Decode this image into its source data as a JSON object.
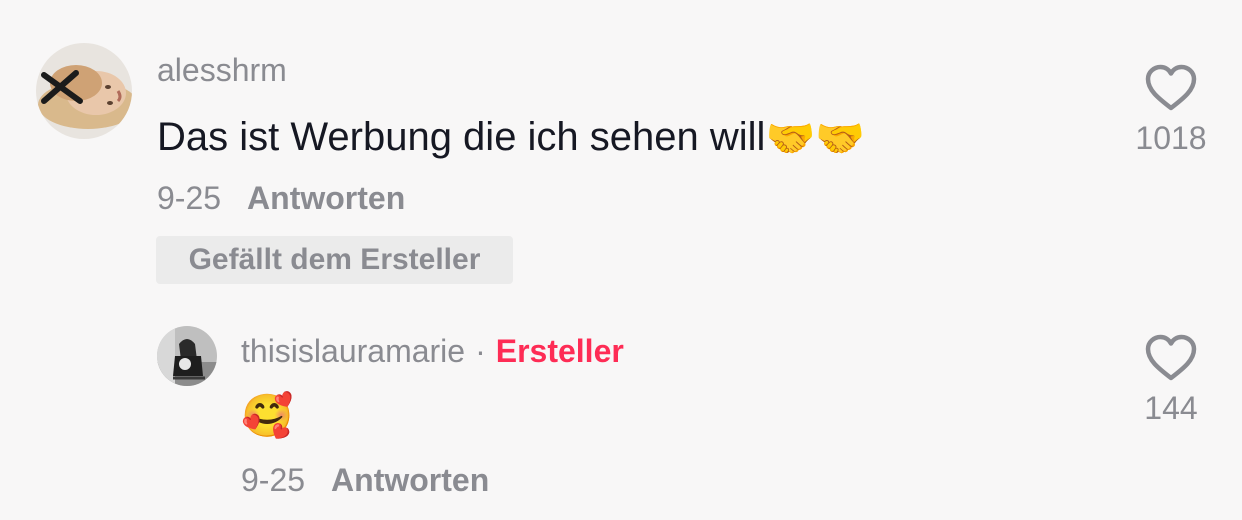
{
  "comments": [
    {
      "username": "alesshrm",
      "text": "Das ist Werbung die ich sehen will",
      "emojis": [
        "🤝",
        "🤝"
      ],
      "date": "9-25",
      "reply_label": "Antworten",
      "badge": "Gefällt dem Ersteller",
      "like_count": "1018",
      "like_icon": "heart-outline-icon"
    }
  ],
  "replies": [
    {
      "username": "thisislauramarie",
      "separator": "·",
      "role_label": "Ersteller",
      "emoji": "🥰",
      "date": "9-25",
      "reply_label": "Antworten",
      "like_count": "144",
      "like_icon": "heart-outline-icon"
    }
  ],
  "colors": {
    "creator_accent": "#fe2c55",
    "muted": "#8a8b91",
    "text": "#161823",
    "background": "#f8f7f7"
  }
}
